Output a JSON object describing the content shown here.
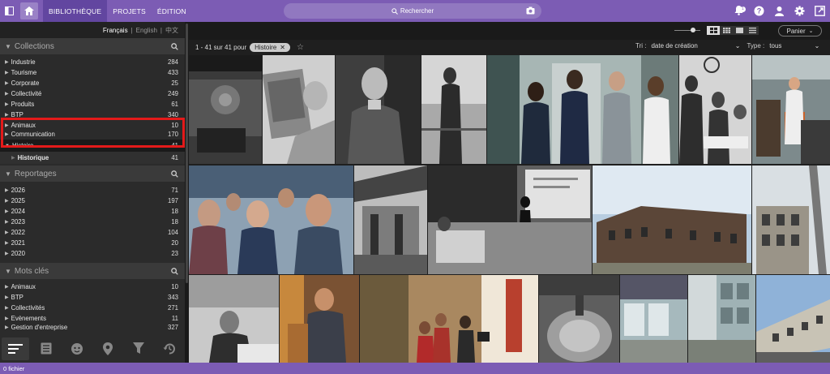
{
  "topbar": {
    "tabs": [
      "BIBLIOTHÈQUE",
      "PROJETS",
      "ÉDITION"
    ],
    "search_placeholder": "Rechercher",
    "notification_count": "1",
    "icons": [
      "sidebar-toggle-icon",
      "home-icon",
      "search-icon",
      "camera-icon",
      "bell-icon",
      "help-icon",
      "user-icon",
      "gear-icon",
      "export-icon"
    ]
  },
  "languages": {
    "fr": "Français",
    "en": "English",
    "zh": "中文"
  },
  "collections": {
    "title": "Collections",
    "items": [
      {
        "label": "Industrie",
        "count": "284"
      },
      {
        "label": "Tourisme",
        "count": "433"
      },
      {
        "label": "Corporate",
        "count": "25"
      },
      {
        "label": "Collectivité",
        "count": "249"
      },
      {
        "label": "Produits",
        "count": "61"
      },
      {
        "label": "BTP",
        "count": "340"
      },
      {
        "label": "Animaux",
        "count": "10"
      },
      {
        "label": "Communication",
        "count": "170"
      },
      {
        "label": "Histoire",
        "count": "41"
      },
      {
        "label": "Historique",
        "count": "41"
      }
    ]
  },
  "reportages": {
    "title": "Reportages",
    "items": [
      {
        "label": "2026",
        "count": "71"
      },
      {
        "label": "2025",
        "count": "197"
      },
      {
        "label": "2024",
        "count": "18"
      },
      {
        "label": "2023",
        "count": "18"
      },
      {
        "label": "2022",
        "count": "104"
      },
      {
        "label": "2021",
        "count": "20"
      },
      {
        "label": "2020",
        "count": "23"
      }
    ]
  },
  "keywords": {
    "title": "Mots clés",
    "items": [
      {
        "label": "Animaux",
        "count": "10"
      },
      {
        "label": "BTP",
        "count": "343"
      },
      {
        "label": "Collectivités",
        "count": "271"
      },
      {
        "label": "Evènements",
        "count": "11"
      },
      {
        "label": "Gestion d'entreprise",
        "count": "327"
      }
    ]
  },
  "toolbar": {
    "result_text": "1 - 41 sur 41 pour",
    "filter_chip": "Histoire",
    "sort_label": "Tri :",
    "sort_value": "date de création",
    "type_label": "Type :",
    "type_value": "tous",
    "cart_label": "Panier"
  },
  "status": {
    "text": "0 fichier"
  },
  "colors": {
    "accent": "#7c5cb4",
    "highlight": "#e31a1a"
  }
}
